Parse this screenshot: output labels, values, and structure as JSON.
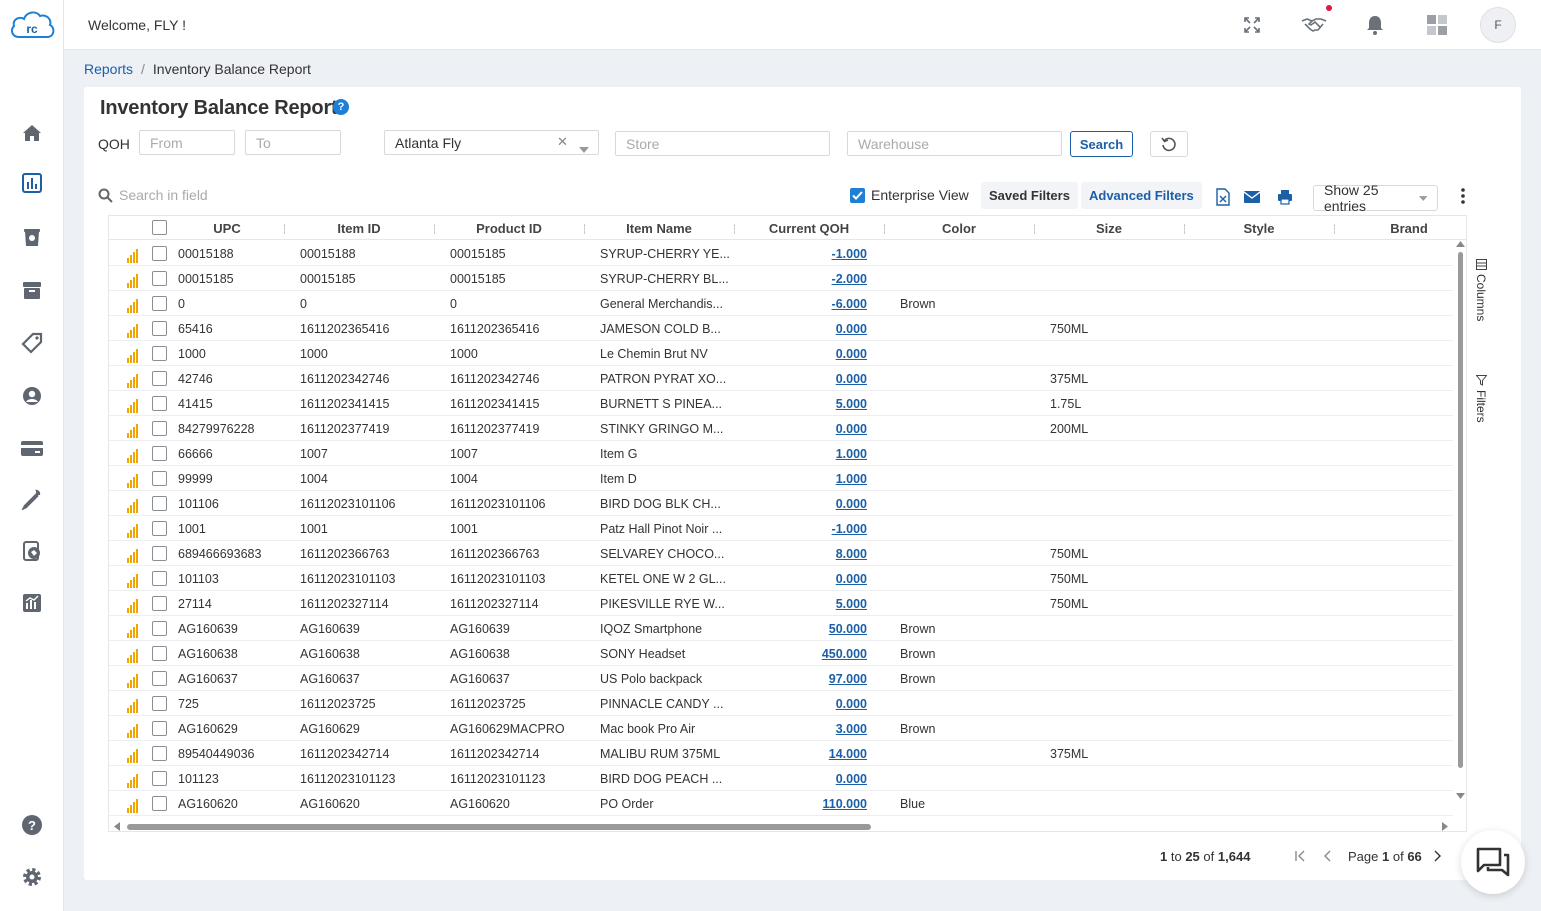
{
  "app": {
    "logo_text": "rc"
  },
  "header": {
    "welcome": "Welcome, FLY !",
    "avatar_initial": "F"
  },
  "breadcrumb": {
    "parent": "Reports",
    "separator": "/",
    "current": "Inventory Balance Report"
  },
  "page": {
    "title": "Inventory Balance Report",
    "help_glyph": "?"
  },
  "filters": {
    "qoh_label": "QOH",
    "from_placeholder": "From",
    "to_placeholder": "To",
    "location_value": "Atlanta Fly",
    "store_placeholder": "Store",
    "warehouse_placeholder": "Warehouse",
    "search_label": "Search"
  },
  "toolbar": {
    "search_placeholder": "Search in field",
    "enterprise_view_label": "Enterprise View",
    "saved_filters_label": "Saved Filters",
    "advanced_filters_label": "Advanced Filters",
    "show_entries_label": "Show 25 entries"
  },
  "side_tabs": {
    "columns": "Columns",
    "filters": "Filters"
  },
  "table": {
    "columns": [
      "UPC",
      "Item ID",
      "Product ID",
      "Item Name",
      "Current QOH",
      "Color",
      "Size",
      "Style",
      "Brand"
    ],
    "rows": [
      {
        "upc": "00015188",
        "item_id": "00015188",
        "product_id": "00015185",
        "name": "SYRUP-CHERRY YE...",
        "qoh": "-1.000",
        "color": "",
        "size": ""
      },
      {
        "upc": "00015185",
        "item_id": "00015185",
        "product_id": "00015185",
        "name": "SYRUP-CHERRY BL...",
        "qoh": "-2.000",
        "color": "",
        "size": ""
      },
      {
        "upc": "0",
        "item_id": "0",
        "product_id": "0",
        "name": "General Merchandis...",
        "qoh": "-6.000",
        "color": "Brown",
        "size": ""
      },
      {
        "upc": "65416",
        "item_id": "1611202365416",
        "product_id": "1611202365416",
        "name": "JAMESON COLD B...",
        "qoh": "0.000",
        "color": "",
        "size": "750ML"
      },
      {
        "upc": "1000",
        "item_id": "1000",
        "product_id": "1000",
        "name": "Le Chemin Brut NV",
        "qoh": "0.000",
        "color": "",
        "size": ""
      },
      {
        "upc": "42746",
        "item_id": "1611202342746",
        "product_id": "1611202342746",
        "name": "PATRON PYRAT XO...",
        "qoh": "0.000",
        "color": "",
        "size": "375ML"
      },
      {
        "upc": "41415",
        "item_id": "1611202341415",
        "product_id": "1611202341415",
        "name": "BURNETT S PINEA...",
        "qoh": "5.000",
        "color": "",
        "size": "1.75L"
      },
      {
        "upc": "84279976228",
        "item_id": "1611202377419",
        "product_id": "1611202377419",
        "name": "STINKY GRINGO M...",
        "qoh": "0.000",
        "color": "",
        "size": "200ML"
      },
      {
        "upc": "66666",
        "item_id": "1007",
        "product_id": "1007",
        "name": "Item G",
        "qoh": "1.000",
        "color": "",
        "size": ""
      },
      {
        "upc": "99999",
        "item_id": "1004",
        "product_id": "1004",
        "name": "Item D",
        "qoh": "1.000",
        "color": "",
        "size": ""
      },
      {
        "upc": "101106",
        "item_id": "16112023101106",
        "product_id": "16112023101106",
        "name": "BIRD DOG BLK CH...",
        "qoh": "0.000",
        "color": "",
        "size": ""
      },
      {
        "upc": "1001",
        "item_id": "1001",
        "product_id": "1001",
        "name": "Patz Hall Pinot Noir ...",
        "qoh": "-1.000",
        "color": "",
        "size": ""
      },
      {
        "upc": "689466693683",
        "item_id": "1611202366763",
        "product_id": "1611202366763",
        "name": "SELVAREY CHOCO...",
        "qoh": "8.000",
        "color": "",
        "size": "750ML"
      },
      {
        "upc": "101103",
        "item_id": "16112023101103",
        "product_id": "16112023101103",
        "name": "KETEL ONE W 2 GL...",
        "qoh": "0.000",
        "color": "",
        "size": "750ML"
      },
      {
        "upc": "27114",
        "item_id": "1611202327114",
        "product_id": "1611202327114",
        "name": "PIKESVILLE RYE W...",
        "qoh": "5.000",
        "color": "",
        "size": "750ML"
      },
      {
        "upc": "AG160639",
        "item_id": "AG160639",
        "product_id": "AG160639",
        "name": "IQOZ Smartphone",
        "qoh": "50.000",
        "color": "Brown",
        "size": ""
      },
      {
        "upc": "AG160638",
        "item_id": "AG160638",
        "product_id": "AG160638",
        "name": "SONY Headset",
        "qoh": "450.000",
        "color": "Brown",
        "size": ""
      },
      {
        "upc": "AG160637",
        "item_id": "AG160637",
        "product_id": "AG160637",
        "name": "US Polo backpack",
        "qoh": "97.000",
        "color": "Brown",
        "size": ""
      },
      {
        "upc": "725",
        "item_id": "16112023725",
        "product_id": "16112023725",
        "name": "PINNACLE CANDY ...",
        "qoh": "0.000",
        "color": "",
        "size": ""
      },
      {
        "upc": "AG160629",
        "item_id": "AG160629",
        "product_id": "AG160629MACPRO",
        "name": "Mac book Pro Air",
        "qoh": "3.000",
        "color": "Brown",
        "size": ""
      },
      {
        "upc": "89540449036",
        "item_id": "1611202342714",
        "product_id": "1611202342714",
        "name": "MALIBU RUM 375ML",
        "qoh": "14.000",
        "color": "",
        "size": "375ML"
      },
      {
        "upc": "101123",
        "item_id": "16112023101123",
        "product_id": "16112023101123",
        "name": "BIRD DOG PEACH ...",
        "qoh": "0.000",
        "color": "",
        "size": ""
      },
      {
        "upc": "AG160620",
        "item_id": "AG160620",
        "product_id": "AG160620",
        "name": "PO Order",
        "qoh": "110.000",
        "color": "Blue",
        "size": ""
      }
    ]
  },
  "pagination": {
    "range_start": "1",
    "to_word": "to",
    "range_end": "25",
    "of_word": "of",
    "total": "1,644",
    "page_word": "Page",
    "current_page": "1",
    "page_of": "of",
    "total_pages": "66"
  },
  "colors": {
    "accent": "#1d7fd6",
    "link": "#1a5fa8",
    "bars": "#f0a500",
    "notify": "#e0163d"
  }
}
